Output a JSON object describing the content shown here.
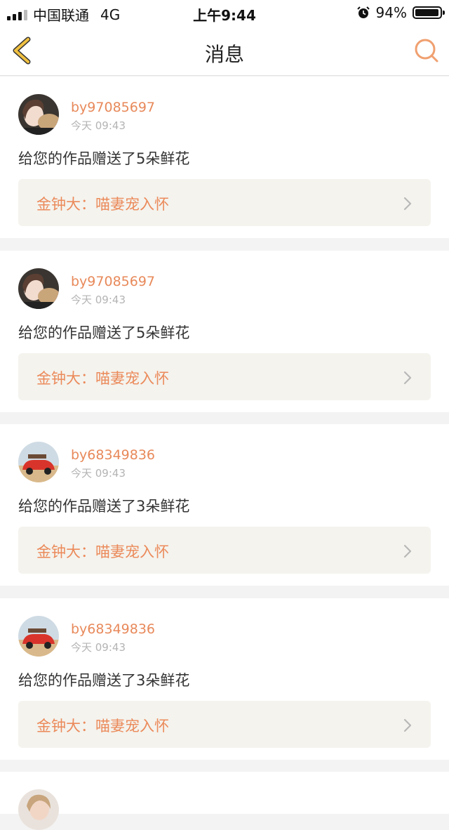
{
  "status_bar": {
    "carrier": "中国联通",
    "network": "4G",
    "time": "上午9:44",
    "battery": "94%"
  },
  "nav": {
    "title": "消息",
    "back_icon": "chevron-left-icon",
    "search_icon": "search-icon"
  },
  "colors": {
    "accent": "#e8895a",
    "back_icon": "#f0c040",
    "card_bg": "#ffffff",
    "link_bg": "#f4f3ee",
    "page_bg": "#f3f3f3"
  },
  "messages": [
    {
      "username": "by97085697",
      "time": "今天 09:43",
      "text": "给您的作品赠送了5朵鲜花",
      "work_title": "金钟大：喵妻宠入怀"
    },
    {
      "username": "by97085697",
      "time": "今天 09:43",
      "text": "给您的作品赠送了5朵鲜花",
      "work_title": "金钟大：喵妻宠入怀"
    },
    {
      "username": "by68349836",
      "time": "今天 09:43",
      "text": "给您的作品赠送了3朵鲜花",
      "work_title": "金钟大：喵妻宠入怀"
    },
    {
      "username": "by68349836",
      "time": "今天 09:43",
      "text": "给您的作品赠送了3朵鲜花",
      "work_title": "金钟大：喵妻宠入怀"
    }
  ]
}
